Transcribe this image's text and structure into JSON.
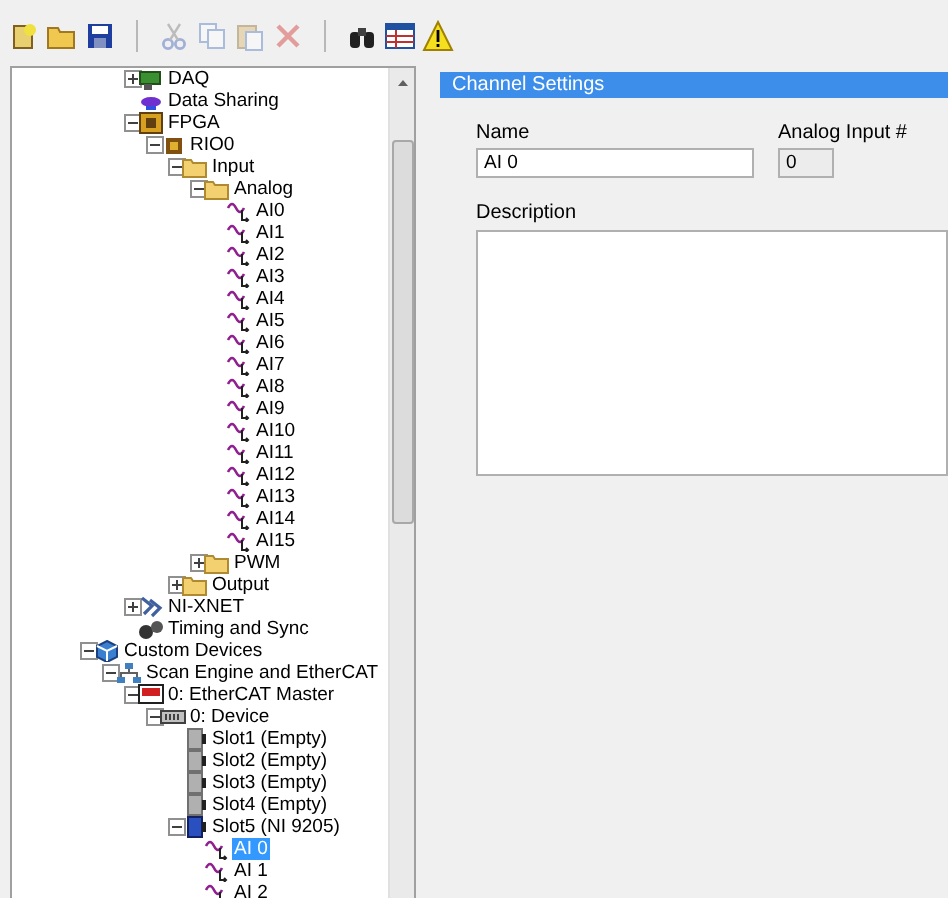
{
  "toolbar": [
    {
      "kind": "new",
      "disabled": false
    },
    {
      "kind": "open",
      "disabled": false
    },
    {
      "kind": "save",
      "disabled": false
    },
    {
      "kind": "separator"
    },
    {
      "kind": "cut",
      "disabled": true
    },
    {
      "kind": "copy",
      "disabled": true
    },
    {
      "kind": "paste",
      "disabled": true
    },
    {
      "kind": "delete",
      "disabled": true
    },
    {
      "kind": "separator"
    },
    {
      "kind": "find",
      "disabled": false
    },
    {
      "kind": "table",
      "disabled": false
    },
    {
      "kind": "warning",
      "disabled": false
    }
  ],
  "tree": {
    "items": [
      {
        "children": [
          {
            "children": [
              {
                "label": "DAQ",
                "kind": "daq",
                "expanded": false,
                "selected": false
              },
              {
                "label": "Data Sharing",
                "kind": "sharing",
                "selected": false
              },
              {
                "label": "FPGA",
                "kind": "fpga",
                "expanded": true,
                "selected": false,
                "children": [
                  {
                    "label": "RIO0",
                    "kind": "chip",
                    "expanded": true,
                    "selected": false,
                    "children": [
                      {
                        "label": "Input",
                        "kind": "folder",
                        "expanded": true,
                        "selected": false,
                        "children": [
                          {
                            "label": "Analog",
                            "kind": "folder",
                            "expanded": true,
                            "selected": false,
                            "children": [
                              {
                                "label": "AI0",
                                "kind": "channel",
                                "selected": false
                              },
                              {
                                "label": "AI1",
                                "kind": "channel",
                                "selected": false
                              },
                              {
                                "label": "AI2",
                                "kind": "channel",
                                "selected": false
                              },
                              {
                                "label": "AI3",
                                "kind": "channel",
                                "selected": false
                              },
                              {
                                "label": "AI4",
                                "kind": "channel",
                                "selected": false
                              },
                              {
                                "label": "AI5",
                                "kind": "channel",
                                "selected": false
                              },
                              {
                                "label": "AI6",
                                "kind": "channel",
                                "selected": false
                              },
                              {
                                "label": "AI7",
                                "kind": "channel",
                                "selected": false
                              },
                              {
                                "label": "AI8",
                                "kind": "channel",
                                "selected": false
                              },
                              {
                                "label": "AI9",
                                "kind": "channel",
                                "selected": false
                              },
                              {
                                "label": "AI10",
                                "kind": "channel",
                                "selected": false
                              },
                              {
                                "label": "AI11",
                                "kind": "channel",
                                "selected": false
                              },
                              {
                                "label": "AI12",
                                "kind": "channel",
                                "selected": false
                              },
                              {
                                "label": "AI13",
                                "kind": "channel",
                                "selected": false
                              },
                              {
                                "label": "AI14",
                                "kind": "channel",
                                "selected": false
                              },
                              {
                                "label": "AI15",
                                "kind": "channel",
                                "selected": false
                              }
                            ]
                          },
                          {
                            "label": "PWM",
                            "kind": "folder",
                            "expanded": false,
                            "selected": false
                          }
                        ]
                      },
                      {
                        "label": "Output",
                        "kind": "folder",
                        "expanded": false,
                        "selected": false
                      }
                    ]
                  }
                ]
              },
              {
                "label": "NI-XNET",
                "kind": "xnet",
                "expanded": false,
                "selected": false
              },
              {
                "label": "Timing and Sync",
                "kind": "timing",
                "selected": false
              }
            ]
          }
        ]
      },
      {
        "label": "Custom Devices",
        "kind": "custom",
        "expanded": true,
        "selected": false,
        "children": [
          {
            "label": "Scan Engine and EtherCAT",
            "kind": "network",
            "expanded": true,
            "selected": false,
            "children": [
              {
                "label": "0: EtherCAT Master",
                "kind": "master",
                "expanded": true,
                "selected": false,
                "children": [
                  {
                    "label": "0: Device",
                    "kind": "device",
                    "expanded": true,
                    "selected": false,
                    "children": [
                      {
                        "label": "Slot1 (Empty)",
                        "kind": "slot_empty",
                        "selected": false
                      },
                      {
                        "label": "Slot2 (Empty)",
                        "kind": "slot_empty",
                        "selected": false
                      },
                      {
                        "label": "Slot3 (Empty)",
                        "kind": "slot_empty",
                        "selected": false
                      },
                      {
                        "label": "Slot4 (Empty)",
                        "kind": "slot_empty",
                        "selected": false
                      },
                      {
                        "label": "Slot5 (NI 9205)",
                        "kind": "slot_module",
                        "expanded": true,
                        "selected": false,
                        "children": [
                          {
                            "label": "AI 0",
                            "kind": "channel",
                            "selected": true
                          },
                          {
                            "label": "AI 1",
                            "kind": "channel",
                            "selected": false
                          },
                          {
                            "label": "AI 2",
                            "kind": "channel",
                            "selected": false
                          }
                        ]
                      }
                    ]
                  }
                ]
              }
            ]
          }
        ]
      }
    ]
  },
  "settings": {
    "title": "Channel Settings",
    "name_label": "Name",
    "name_value": "AI 0",
    "number_label": "Analog Input #",
    "number_value": "0",
    "description_label": "Description"
  }
}
